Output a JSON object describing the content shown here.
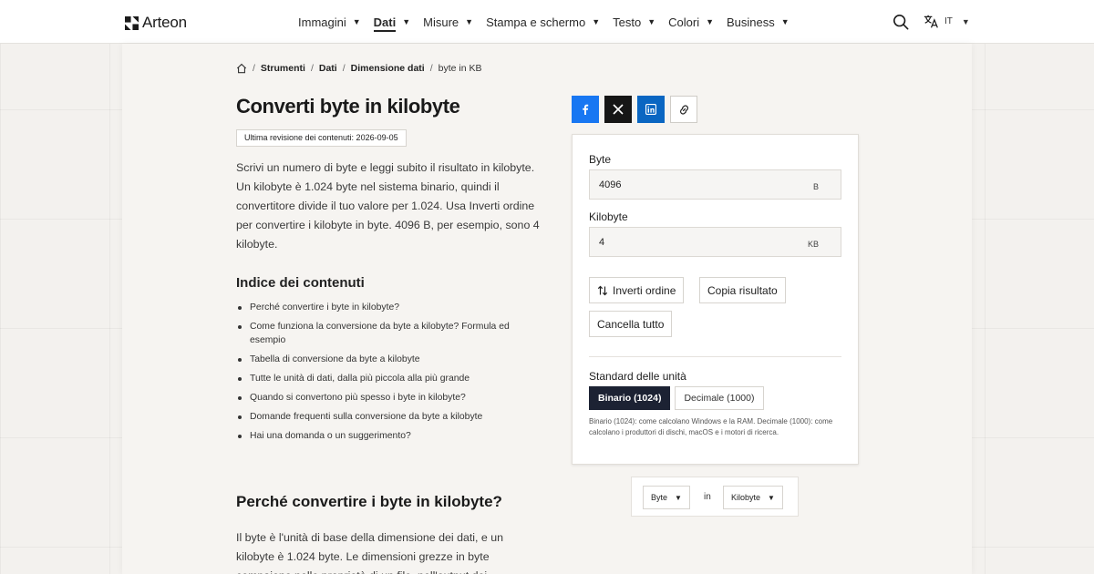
{
  "header": {
    "logo": "Arteon",
    "nav": [
      {
        "label": "Immagini",
        "active": false
      },
      {
        "label": "Dati",
        "active": true
      },
      {
        "label": "Misure",
        "active": false
      },
      {
        "label": "Stampa e schermo",
        "active": false
      },
      {
        "label": "Testo",
        "active": false
      },
      {
        "label": "Colori",
        "active": false
      },
      {
        "label": "Business",
        "active": false
      }
    ],
    "language": "IT"
  },
  "breadcrumb": {
    "items": [
      "Strumenti",
      "Dati",
      "Dimensione dati"
    ],
    "current": "byte in KB"
  },
  "page": {
    "title": "Converti byte in kilobyte",
    "revision": "Ultima revisione dei contenuti: 2026-09-05",
    "intro": "Scrivi un numero di byte e leggi subito il risultato in kilobyte. Un kilobyte è 1.024 byte nel sistema binario, quindi il convertitore divide il tuo valore per 1.024. Usa Inverti ordine per convertire i kilobyte in byte. 4096 B, per esempio, sono 4 kilobyte.",
    "toc_title": "Indice dei contenuti",
    "toc": [
      "Perché convertire i byte in kilobyte?",
      "Come funziona la conversione da byte a kilobyte? Formula ed esempio",
      "Tabella di conversione da byte a kilobyte",
      "Tutte le unità di dati, dalla più piccola alla più grande",
      "Quando si convertono più spesso i byte in kilobyte?",
      "Domande frequenti sulla conversione da byte a kilobyte",
      "Hai una domanda o un suggerimento?"
    ],
    "section_title": "Perché convertire i byte in kilobyte?",
    "section_text": "Il byte è l'unità di base della dimensione dei dati, e un kilobyte è 1.024 byte. Le dimensioni grezze in byte compaiono nelle proprietà di un file, nell'output dei"
  },
  "converter": {
    "input_label": "Byte",
    "input_value": "4096",
    "input_unit": "B",
    "output_label": "Kilobyte",
    "output_value": "4",
    "output_unit": "KB",
    "swap_label": "Inverti ordine",
    "copy_label": "Copia risultato",
    "clear_label": "Cancella tutto",
    "standard_label": "Standard delle unità",
    "standard_binary": "Binario (1024)",
    "standard_decimal": "Decimale (1000)",
    "standard_selected": "Binario (1024)",
    "standard_note": "Binario (1024): come calcolano Windows e la RAM. Decimale (1000): come calcolano i produttori di dischi, macOS e i motori di ricerca."
  },
  "unit_selector": {
    "from": "Byte",
    "connector": "in",
    "to": "Kilobyte"
  },
  "colors": {
    "facebook": "#1877f2",
    "x": "#161616",
    "linkedin": "#0a66c2",
    "active_segment": "#1c2233"
  }
}
